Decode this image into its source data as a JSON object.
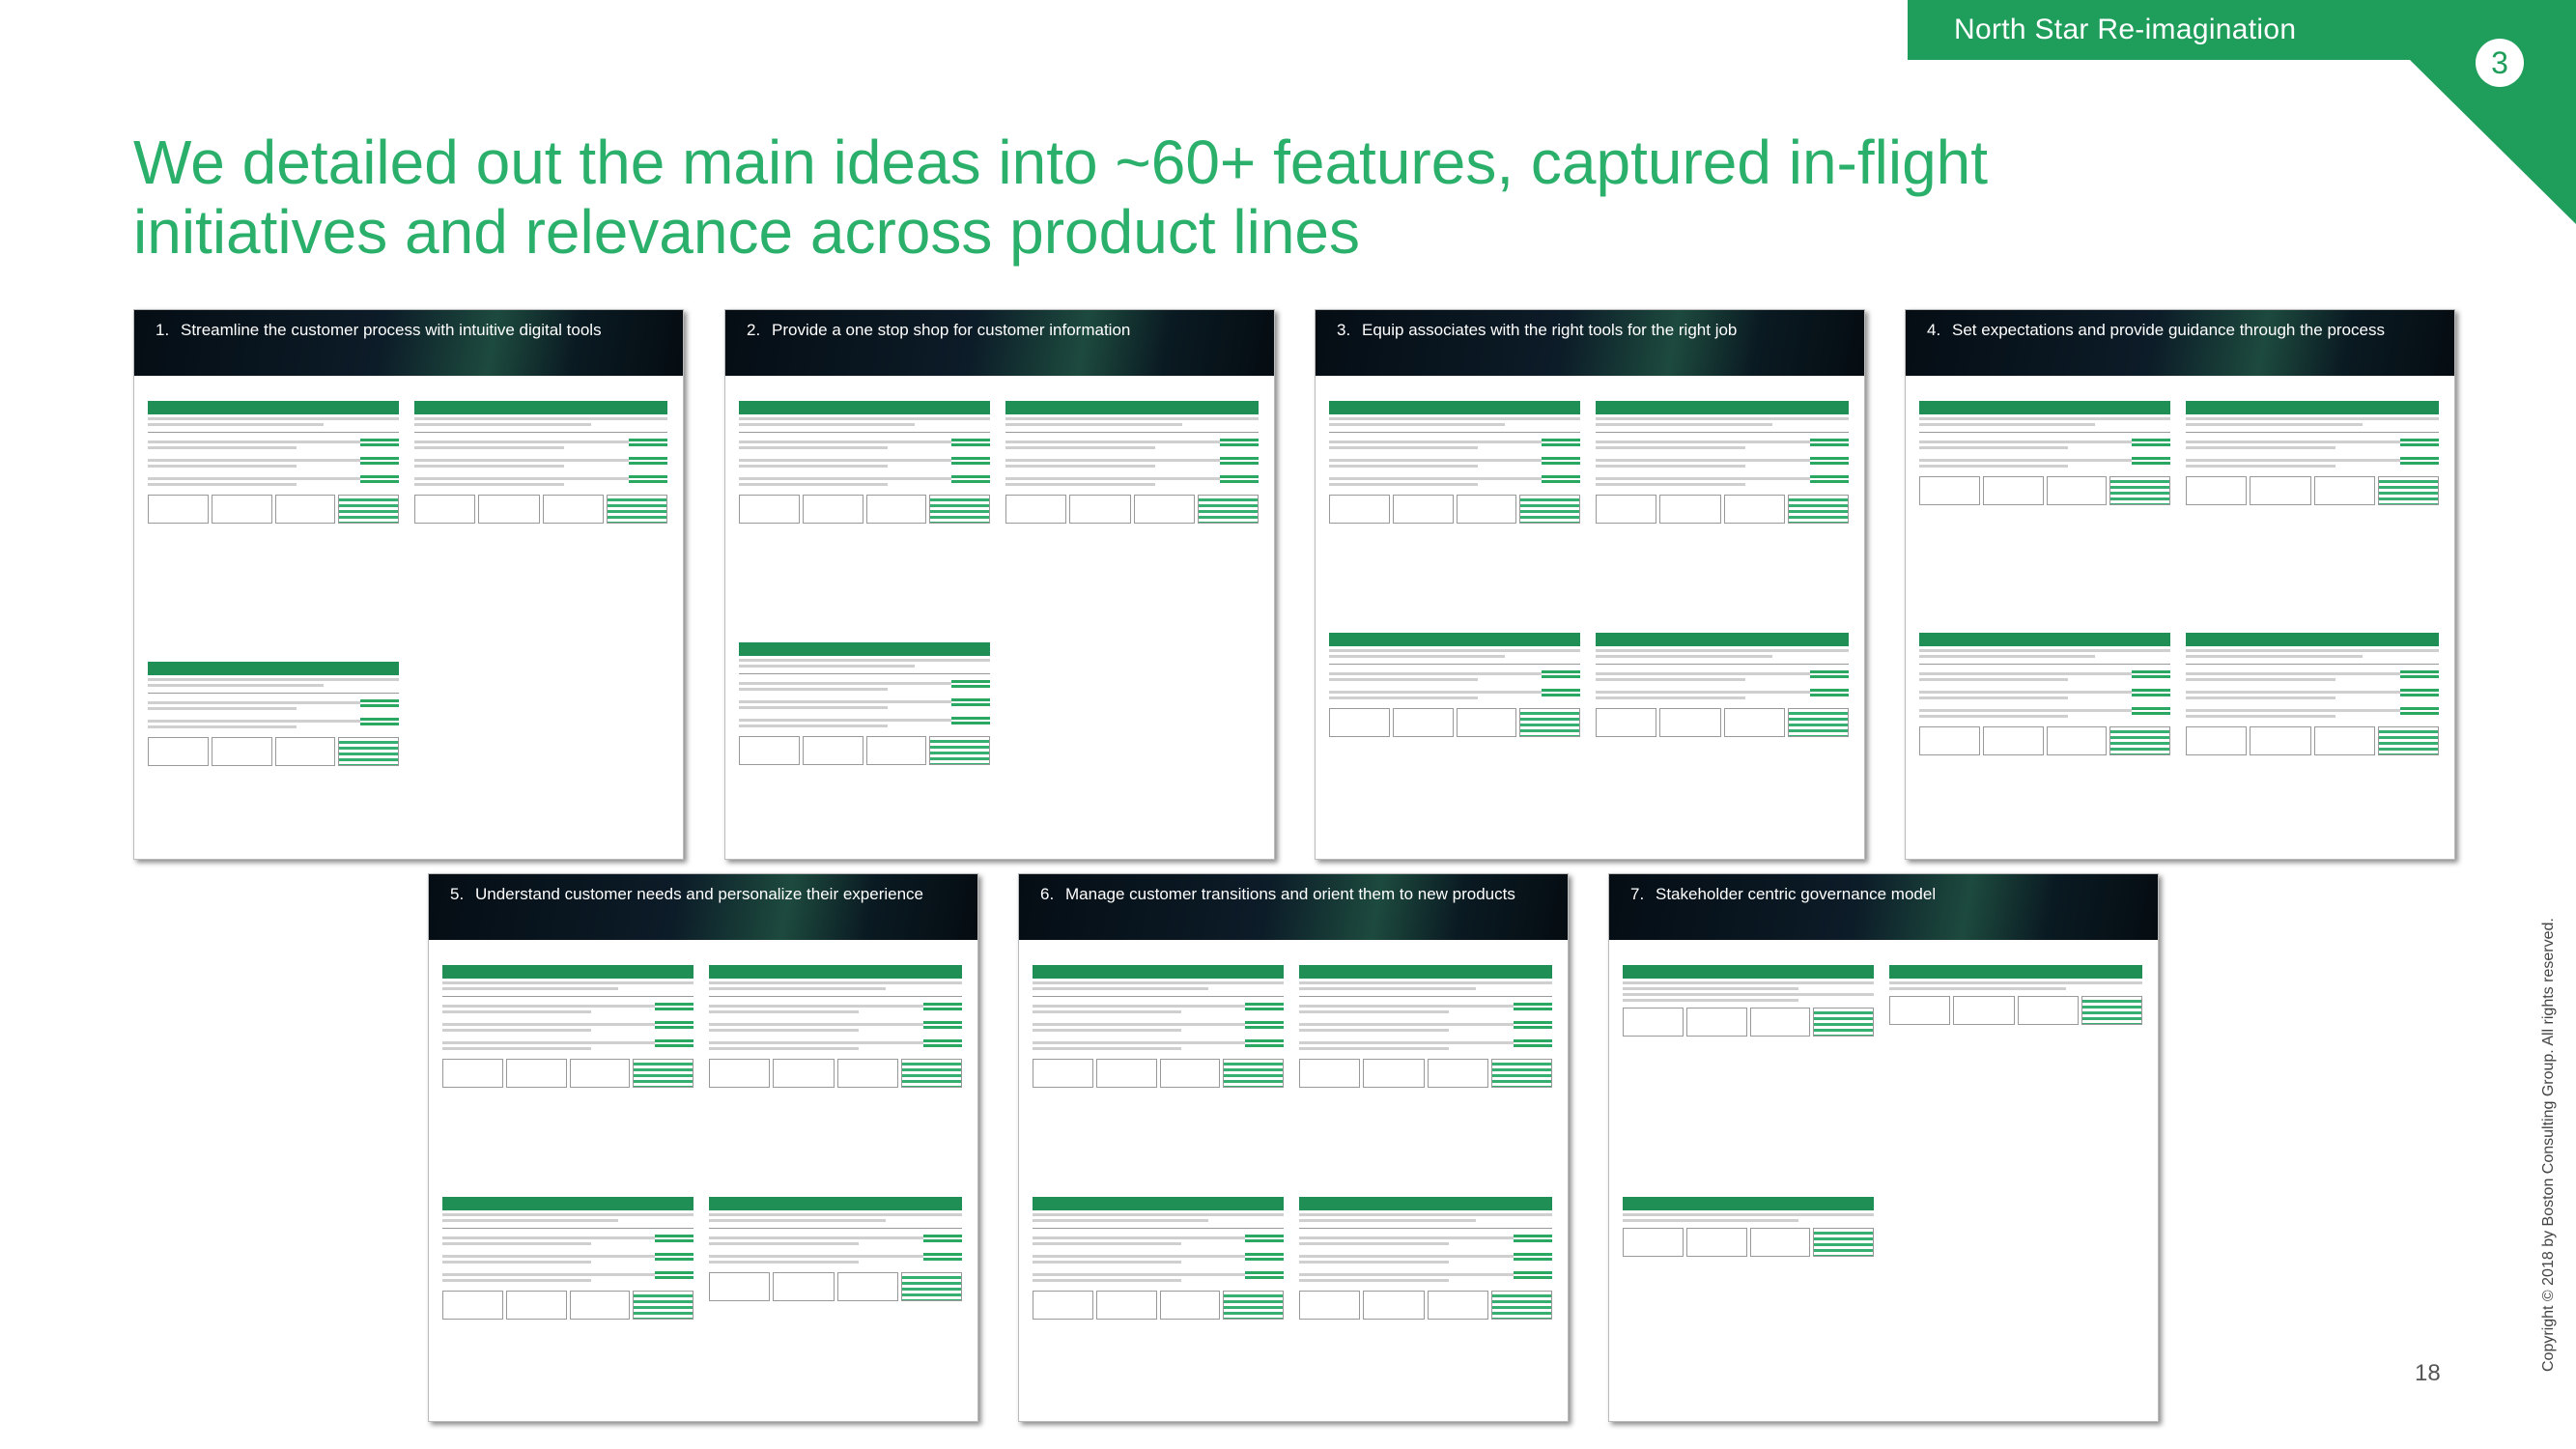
{
  "header": {
    "banner_label": "North Star Re-imagination",
    "section_number": "3",
    "title_line1": "We detailed out the main ideas into ~60+ features, captured in-flight",
    "title_line2": "initiatives and relevance across product lines"
  },
  "thumbnails": [
    {
      "number": "1.",
      "title": "Streamline the customer process with intuitive digital tools"
    },
    {
      "number": "2.",
      "title": "Provide a one stop shop for customer information"
    },
    {
      "number": "3.",
      "title": "Equip associates with the right tools for the right job"
    },
    {
      "number": "4.",
      "title": "Set expectations and provide guidance through the process"
    },
    {
      "number": "5.",
      "title": "Understand customer needs and personalize their experience"
    },
    {
      "number": "6.",
      "title": "Manage customer transitions and orient them to new products"
    },
    {
      "number": "7.",
      "title": "Stakeholder centric governance model"
    }
  ],
  "footer": {
    "page_number": "18",
    "copyright": "Copyright © 2018 by Boston Consulting Group. All rights reserved."
  },
  "colors": {
    "brand_green": "#1f9e5b",
    "title_green": "#2bb06b"
  }
}
